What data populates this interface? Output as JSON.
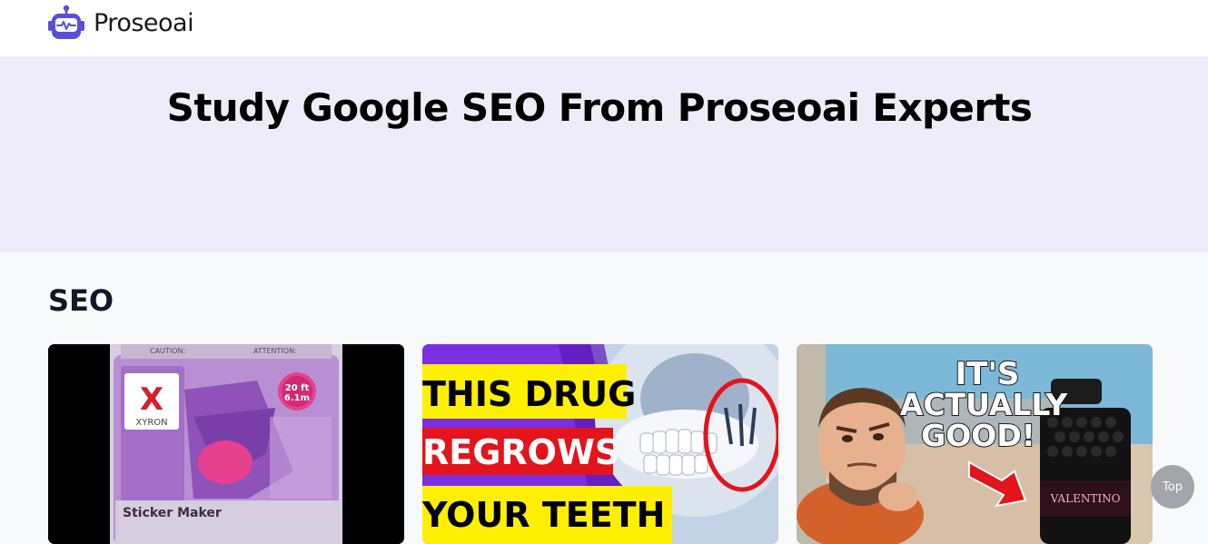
{
  "header": {
    "brand_name": "Proseoai",
    "logo_icon": "robot-icon",
    "brand_color": "#5b4fd6"
  },
  "hero": {
    "title": "Study Google SEO From Proseoai Experts",
    "background": "#eeecf8"
  },
  "section": {
    "title": "SEO"
  },
  "cards": [
    {
      "thumbnail": "sticker-maker-package",
      "text": {
        "caution": "CAUTION:",
        "attention": "ATTENTION:",
        "brand": "XYRON",
        "size": "20 ft",
        "size_metric": "6.1m",
        "product": "Sticker Maker"
      }
    },
    {
      "thumbnail": "teeth-regrowth-drug",
      "text": {
        "line1": "THIS DRUG",
        "line2": "REGROWS",
        "line3": "YOUR TEETH"
      }
    },
    {
      "thumbnail": "valentino-fragrance-review",
      "text": {
        "line1": "IT'S",
        "line2": "ACTUALLY",
        "line3": "GOOD!",
        "bottle_label": "VALENTINO"
      }
    }
  ],
  "back_to_top": {
    "label": "Top"
  }
}
